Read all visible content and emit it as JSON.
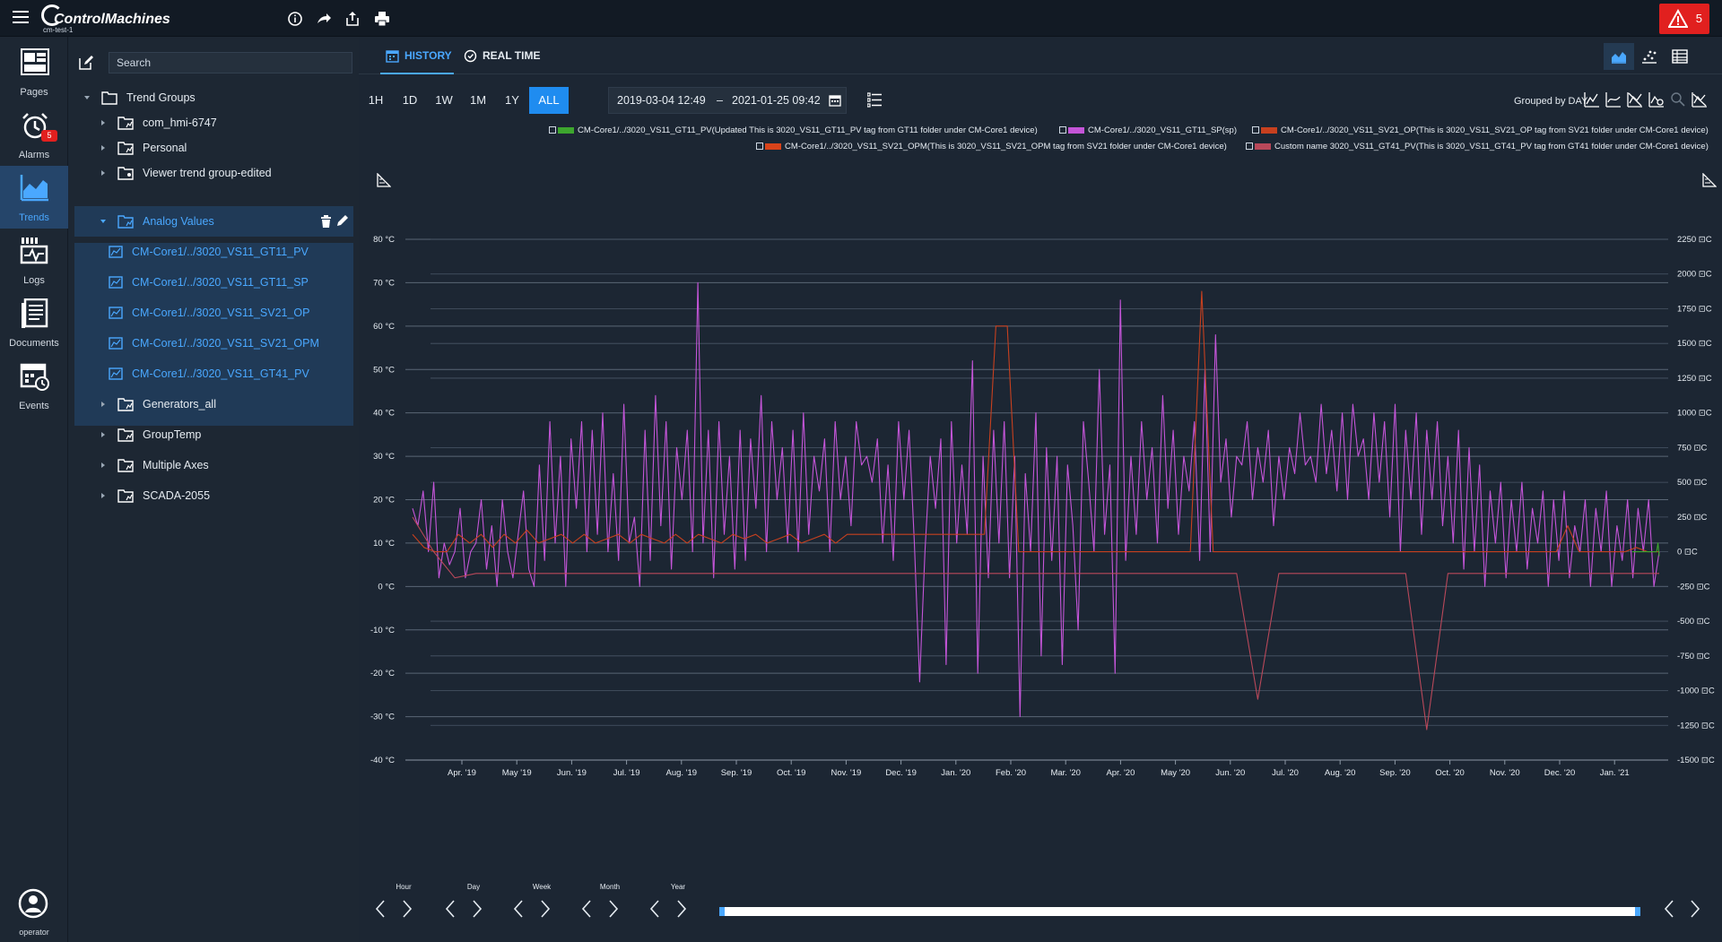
{
  "app": {
    "brand": "ControlMachines",
    "instance": "cm-test-1",
    "alarm_count": "5"
  },
  "nav": {
    "items": [
      {
        "label": "Pages"
      },
      {
        "label": "Alarms",
        "badge": "5"
      },
      {
        "label": "Trends"
      },
      {
        "label": "Logs"
      },
      {
        "label": "Documents"
      },
      {
        "label": "Events"
      }
    ],
    "user": "operator"
  },
  "tree": {
    "search_placeholder": "Search",
    "root": "Trend Groups",
    "groups": [
      {
        "label": "com_hmi-6747"
      },
      {
        "label": "Personal"
      },
      {
        "label": "Viewer trend group-edited"
      },
      {
        "label": "Analog Values"
      },
      {
        "label": "Generators_all"
      },
      {
        "label": "GroupTemp"
      },
      {
        "label": "Multiple Axes"
      },
      {
        "label": "SCADA-2055"
      }
    ],
    "leaves": [
      {
        "label": "CM-Core1/../3020_VS11_GT11_PV"
      },
      {
        "label": "CM-Core1/../3020_VS11_GT11_SP"
      },
      {
        "label": "CM-Core1/../3020_VS11_SV21_OP"
      },
      {
        "label": "CM-Core1/../3020_VS11_SV21_OPM"
      },
      {
        "label": "CM-Core1/../3020_VS11_GT41_PV"
      }
    ]
  },
  "tabs": {
    "history": "HISTORY",
    "realtime": "REAL TIME"
  },
  "range_buttons": [
    "1H",
    "1D",
    "1W",
    "1M",
    "1Y",
    "ALL"
  ],
  "date_range": {
    "from": "2019-03-04 12:49",
    "sep": "–",
    "to": "2021-01-25 09:42"
  },
  "grouped_by": "Grouped by DAY",
  "colors": {
    "pv": "#3da62e",
    "sp": "#c455d8",
    "op": "#c7401f",
    "opm": "#d9431a",
    "gt41": "#b9485a",
    "accent": "#1f8cf0"
  },
  "legend": [
    {
      "label": "CM-Core1/../3020_VS11_GT11_PV(Updated This is 3020_VS11_GT11_PV tag from GT11 folder under CM-Core1 device)",
      "color": "#3da62e"
    },
    {
      "label": "CM-Core1/../3020_VS11_GT11_SP(sp)",
      "color": "#c455d8"
    },
    {
      "label": "CM-Core1/../3020_VS11_SV21_OP(This is 3020_VS11_SV21_OP tag from SV21 folder under CM-Core1 device)",
      "color": "#c7401f"
    },
    {
      "label": "CM-Core1/../3020_VS11_SV21_OPM(This is 3020_VS11_SV21_OPM tag from SV21 folder under CM-Core1 device)",
      "color": "#d9431a"
    },
    {
      "label": "Custom name 3020_VS11_GT41_PV(This is 3020_VS11_GT41_PV tag from GT41 folder under CM-Core1 device)",
      "color": "#b9485a"
    }
  ],
  "chart_data": {
    "type": "line",
    "left_axis": {
      "ticks": [
        "80 °C",
        "70 °C",
        "60 °C",
        "50 °C",
        "40 °C",
        "30 °C",
        "20 °C",
        "10 °C",
        "0 °C",
        "-10 °C",
        "-20 °C",
        "-30 °C",
        "-40 °C"
      ],
      "ylim": [
        -40,
        80
      ]
    },
    "right_axis": {
      "ticks": [
        "2250 ⊡C",
        "2000 ⊡C",
        "1750 ⊡C",
        "1500 ⊡C",
        "1250 ⊡C",
        "1000 ⊡C",
        "750 ⊡C",
        "500 ⊡C",
        "250 ⊡C",
        "0 ⊡C",
        "-250 ⊡C",
        "-500 ⊡C",
        "-750 ⊡C",
        "-1000 ⊡C",
        "-1250 ⊡C",
        "-1500 ⊡C"
      ],
      "ylim": [
        -1500,
        2250
      ]
    },
    "x_ticks": [
      "Apr. '19",
      "May '19",
      "Jun. '19",
      "Jul. '19",
      "Aug. '19",
      "Sep. '19",
      "Oct. '19",
      "Nov. '19",
      "Dec. '19",
      "Jan. '20",
      "Feb. '20",
      "Mar. '20",
      "Apr. '20",
      "May '20",
      "Jun. '20",
      "Jul. '20",
      "Aug. '20",
      "Sep. '20",
      "Oct. '20",
      "Nov. '20",
      "Dec. '20",
      "Jan. '21"
    ],
    "grid": true,
    "series": [
      {
        "color": "#c455d8",
        "values": [
          18,
          14,
          22,
          8,
          24,
          2,
          10,
          5,
          8,
          18,
          2,
          8,
          10,
          20,
          4,
          14,
          0,
          20,
          8,
          2,
          12,
          22,
          4,
          0,
          28,
          6,
          38,
          10,
          30,
          0,
          34,
          18,
          38,
          8,
          36,
          12,
          40,
          8,
          26,
          6,
          42,
          10,
          16,
          0,
          36,
          6,
          44,
          14,
          38,
          4,
          32,
          20,
          36,
          8,
          70,
          10,
          36,
          2,
          38,
          12,
          30,
          4,
          36,
          6,
          34,
          18,
          44,
          8,
          38,
          20,
          32,
          10,
          36,
          8,
          40,
          12,
          30,
          22,
          34,
          8,
          38,
          20,
          30,
          14,
          38,
          28,
          30,
          24,
          34,
          10,
          28,
          6,
          38,
          20,
          36,
          10,
          -22,
          8,
          30,
          18,
          34,
          -18,
          38,
          10,
          28,
          12,
          52,
          -20,
          30,
          2,
          36,
          10,
          38,
          2,
          30,
          -30,
          26,
          8,
          40,
          -16,
          32,
          6,
          30,
          -18,
          28,
          14,
          -10,
          38,
          24,
          8,
          50,
          12,
          28,
          -20,
          66,
          6,
          30,
          12,
          38,
          20,
          32,
          10,
          44,
          18,
          36,
          12,
          30,
          22,
          38,
          6,
          50,
          8,
          58,
          24,
          34,
          16,
          30,
          28,
          38,
          20,
          32,
          24,
          36,
          14,
          30,
          20,
          32,
          26,
          40,
          28,
          30,
          24,
          42,
          26,
          36,
          22,
          40,
          20,
          42,
          30,
          34,
          20,
          40,
          24,
          38,
          16,
          42,
          8,
          36,
          20,
          40,
          12,
          36,
          20,
          38,
          14,
          30,
          10,
          36,
          4,
          32,
          8,
          28,
          0,
          22,
          10,
          24,
          2,
          20,
          8,
          24,
          4,
          18,
          10,
          22,
          0,
          20,
          6,
          22,
          2,
          14,
          8,
          20,
          0,
          18,
          8,
          22,
          0,
          14,
          6,
          20,
          2,
          18,
          8,
          20,
          0,
          8
        ]
      },
      {
        "color": "#c7401f",
        "values": [
          12,
          9,
          8,
          8,
          12,
          10,
          12,
          9,
          12,
          10,
          13,
          10,
          11,
          12,
          10,
          12,
          10,
          11,
          12,
          10,
          12,
          11,
          10,
          12,
          10,
          12,
          11,
          10,
          12,
          11,
          12,
          10,
          11,
          12,
          10,
          11,
          12,
          10,
          12,
          12,
          12,
          12,
          12,
          12,
          12,
          12,
          12,
          12,
          12,
          12,
          12,
          60,
          60,
          8,
          8,
          8,
          8,
          8,
          8,
          8,
          8,
          8,
          8,
          8,
          8,
          8,
          8,
          8,
          8,
          68,
          8,
          8,
          8,
          8,
          8,
          8,
          8,
          8,
          8,
          8,
          8,
          8,
          8,
          8,
          8,
          8,
          8,
          8,
          8,
          8,
          8,
          8,
          8,
          8,
          8,
          8,
          8,
          8,
          8,
          8,
          8,
          14,
          8,
          8,
          8,
          8,
          8,
          9,
          8,
          8
        ]
      },
      {
        "color": "#b9485a",
        "values": [
          16,
          8,
          2,
          3,
          3,
          3,
          3,
          3,
          3,
          3,
          3,
          3,
          3,
          3,
          3,
          3,
          3,
          3,
          3,
          3,
          3,
          3,
          3,
          3,
          3,
          3,
          3,
          3,
          3,
          3,
          3,
          3,
          3,
          3,
          3,
          3,
          3,
          3,
          3,
          3,
          -26,
          3,
          3,
          3,
          3,
          3,
          3,
          3,
          -33,
          3,
          3,
          3,
          3,
          3,
          3,
          3,
          3,
          3,
          3,
          3
        ]
      },
      {
        "color": "#3da62e",
        "values": [
          8,
          8,
          8,
          8,
          8,
          8,
          8,
          8,
          8,
          8,
          8,
          8,
          8,
          8,
          8,
          8,
          8,
          8,
          8,
          8,
          10,
          7
        ]
      }
    ]
  },
  "navigator": {
    "groups": [
      "Hour",
      "Day",
      "Week",
      "Month",
      "Year"
    ]
  }
}
